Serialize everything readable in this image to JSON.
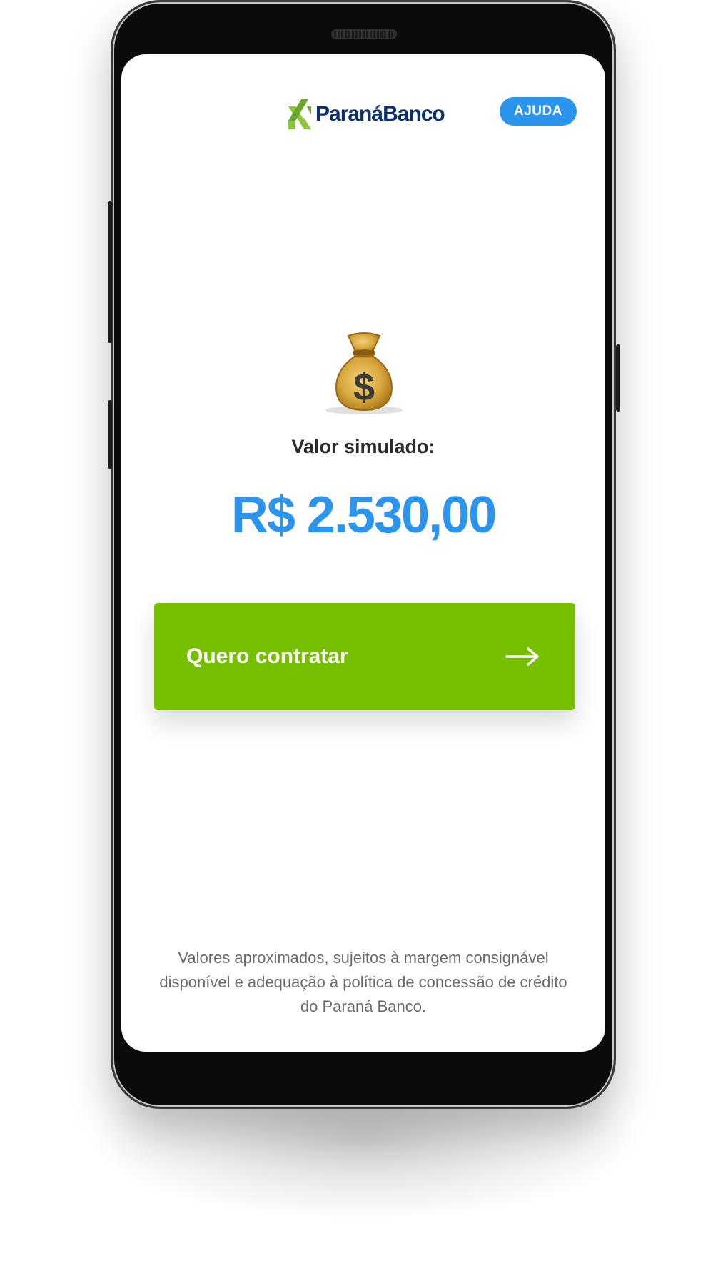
{
  "header": {
    "brand_name": "ParanáBanco",
    "help_label": "AJUDA"
  },
  "main": {
    "icon": "money-bag-icon",
    "label": "Valor simulado:",
    "amount": "R$ 2.530,00",
    "cta_label": "Quero contratar",
    "cta_icon": "arrow-right-icon"
  },
  "footer": {
    "disclaimer": "Valores aproximados, sujeitos à margem consignável disponível e adequação à política de concessão de crédito do Paraná Banco."
  },
  "colors": {
    "accent_blue": "#2b95ee",
    "cta_green": "#76bf00",
    "brand_navy": "#0a2f6e",
    "brand_lime": "#8cc63f"
  }
}
